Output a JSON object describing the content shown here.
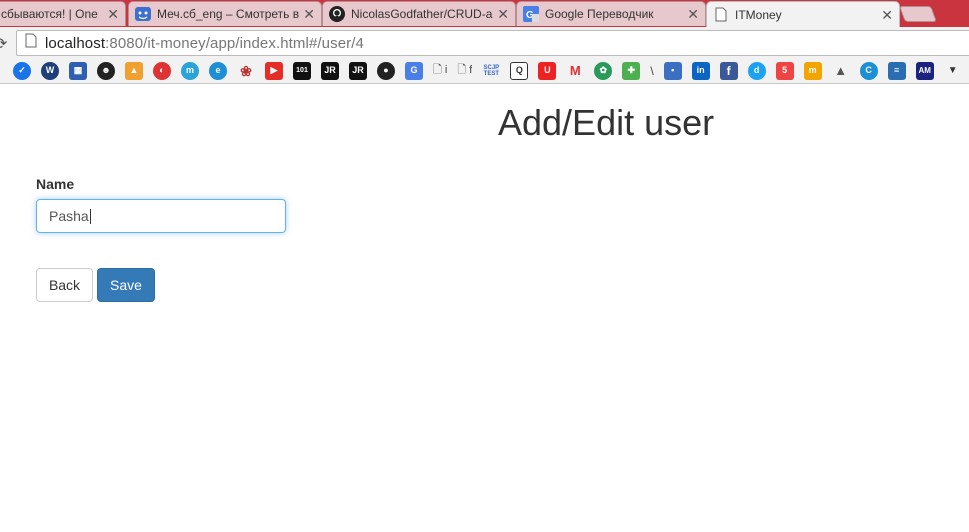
{
  "browser": {
    "tabs": [
      {
        "title": "сбываются! | One",
        "icon": "page-icon"
      },
      {
        "title": "Меч.сб_eng – Смотреть в",
        "icon": "video-site-icon"
      },
      {
        "title": "NicolasGodfather/CRUD-a",
        "icon": "github-icon"
      },
      {
        "title": "Google Переводчик",
        "icon": "google-translate-icon"
      },
      {
        "title": "ITMoney",
        "icon": "page-icon"
      }
    ],
    "url_host": "localhost",
    "url_rest": ":8080/it-money/app/index.html#/user/4",
    "bookmarks_text": {
      "doc1": "i",
      "doc2": "f",
      "scjp": "SCJP TEST",
      "jr1": "JR",
      "jr2": "JR",
      "am": "AM",
      "slash": "\\"
    }
  },
  "page": {
    "title": "Add/Edit user",
    "name_label": "Name",
    "name_value": "Pasha",
    "back_label": "Back",
    "save_label": "Save"
  },
  "colors": {
    "tabstrip": "#c9343e",
    "primary_button": "#337ab7",
    "focus_border": "#66afe9"
  }
}
